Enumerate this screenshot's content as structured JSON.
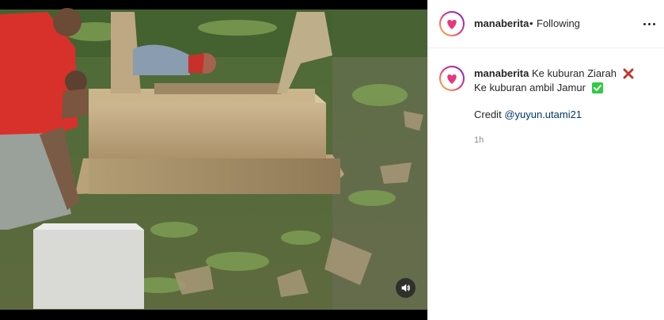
{
  "post": {
    "username": "manaberita",
    "separator": "•",
    "follow_status": "Following",
    "avatar_label": "manaberita",
    "caption": {
      "line1": "Ke kuburan Ziarah",
      "line2": "Ke kuburan ambil Jamur",
      "credit_label": "Credit",
      "credit_mention": "@yuyun.utami21"
    },
    "time": "1h"
  },
  "icons": {
    "more": "more-options-icon",
    "sound": "speaker-icon",
    "cross": "cross-mark-emoji",
    "check": "check-mark-emoji"
  },
  "colors": {
    "brand_pink": "#e8377a",
    "link": "#00376b",
    "muted": "#8e8e8e",
    "cross_red": "#c0392b",
    "check_green": "#2ecc40"
  }
}
